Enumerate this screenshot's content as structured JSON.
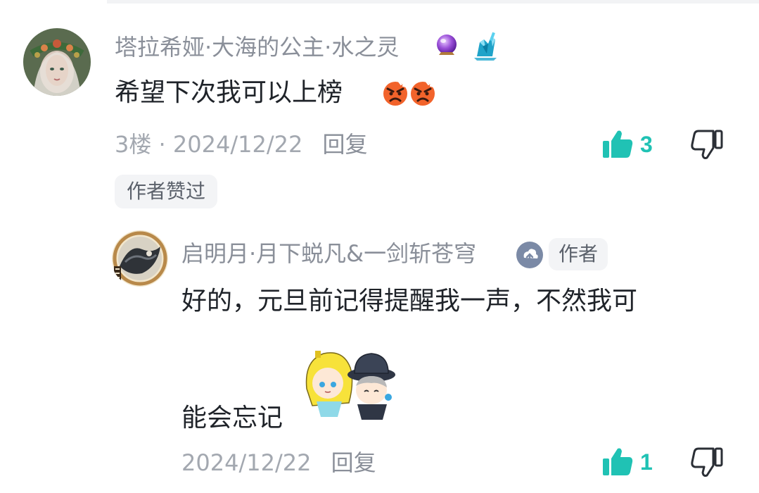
{
  "comment": {
    "username": "塔拉希娅·大海的公主·水之灵",
    "text": "希望下次我可以上榜",
    "floor": "3楼",
    "separator": "·",
    "date": "2024/12/22",
    "reply_label": "回复",
    "like_count": "3",
    "author_liked_label": "作者赞过",
    "badges": [
      "crystal-ball-icon",
      "crystal-hand-icon"
    ],
    "emojis": [
      "angry-face-emoji",
      "angry-face-emoji"
    ]
  },
  "reply": {
    "username": "启明月·月下蜕凡&一剑斩苍穹",
    "author_label": "作者",
    "text_line1": "好的，元旦前记得提醒我一声，不然我可",
    "text_line2": "能会忘记",
    "date": "2024/12/22",
    "reply_label": "回复",
    "like_count": "1",
    "badges": [
      "upload-icon"
    ],
    "sticker": "anime-characters-sticker"
  },
  "colors": {
    "accent_like": "#20c2b4",
    "username": "#8a8f99",
    "meta": "#a3a8b0",
    "text": "#1f2329",
    "tag_bg": "#f3f4f6"
  }
}
